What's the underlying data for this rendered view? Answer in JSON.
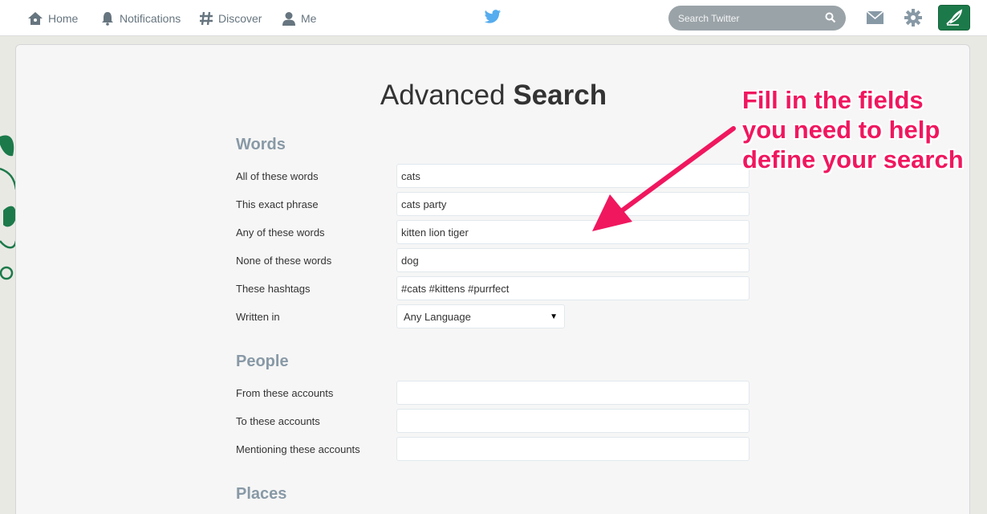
{
  "nav": {
    "home": "Home",
    "notifications": "Notifications",
    "discover": "Discover",
    "me": "Me"
  },
  "search": {
    "placeholder": "Search Twitter"
  },
  "colors": {
    "brand_blue": "#55acee",
    "compose_green": "#1c7a4a",
    "annotation_pink": "#f0175f"
  },
  "page": {
    "title_light": "Advanced",
    "title_bold": "Search"
  },
  "sections": {
    "words": {
      "heading": "Words",
      "fields": [
        {
          "label": "All of these words",
          "value": "cats"
        },
        {
          "label": "This exact phrase",
          "value": "cats party"
        },
        {
          "label": "Any of these words",
          "value": "kitten lion tiger"
        },
        {
          "label": "None of these words",
          "value": "dog"
        },
        {
          "label": "These hashtags",
          "value": "#cats #kittens #purrfect"
        }
      ],
      "written_in": {
        "label": "Written in",
        "value": "Any Language"
      }
    },
    "people": {
      "heading": "People",
      "fields": [
        {
          "label": "From these accounts",
          "value": ""
        },
        {
          "label": "To these accounts",
          "value": ""
        },
        {
          "label": "Mentioning these accounts",
          "value": ""
        }
      ]
    },
    "places": {
      "heading": "Places"
    }
  },
  "annotation": {
    "line1": "Fill in the fields",
    "line2": "you need to help",
    "line3": "define your search"
  }
}
